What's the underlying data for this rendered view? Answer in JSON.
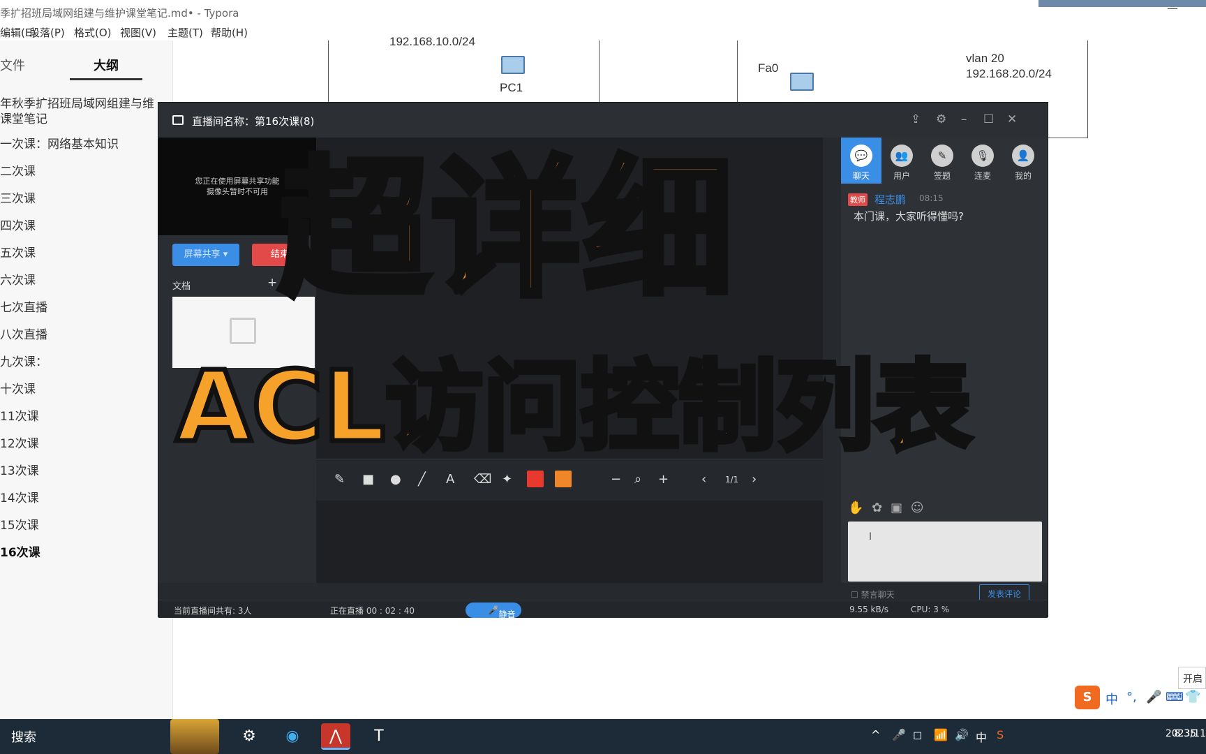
{
  "window": {
    "title": "季扩招班局域网组建与维护课堂笔记.md• - Typora"
  },
  "menu": [
    "编辑(E)",
    "段落(P)",
    "格式(O)",
    "视图(V)",
    "主题(T)",
    "帮助(H)"
  ],
  "sidebar": {
    "tabs": [
      "文件",
      "大纲"
    ],
    "active_tab": "大纲",
    "outline": [
      "年秋季扩招班局域网组建与维",
      "课堂笔记",
      "一次课：网络基本知识",
      "二次课",
      "三次课",
      "四次课",
      "五次课",
      "六次课",
      "七次直播",
      "八次直播",
      "九次课：",
      "十次课",
      "11次课",
      "12次课",
      "13次课",
      "14次课",
      "15次课",
      "16次课"
    ],
    "active_item": "16次课",
    "bottom_controls": [
      "<",
      "</>"
    ]
  },
  "diagram": {
    "subnet1": "192.168.10.0/24",
    "pc1": "PC1",
    "port": "Fa0",
    "vlan": "vlan 20",
    "subnet2": "192.168.20.0/24"
  },
  "live": {
    "title": "直播间名称：第16次课(8)",
    "camera_notice": "您正在使用屏幕共享功能\n摄像头暂时不可用",
    "share_button": "屏幕共享 ▾",
    "red_button": "结束",
    "doc_label": "文档",
    "doc_add": "+",
    "right_tabs": [
      {
        "label": "聊天",
        "icon": "chat-icon"
      },
      {
        "label": "用户",
        "icon": "users-icon"
      },
      {
        "label": "签题",
        "icon": "pen-icon"
      },
      {
        "label": "连麦",
        "icon": "mic-icon"
      },
      {
        "label": "我的",
        "icon": "profile-icon"
      }
    ],
    "active_right_tab": "聊天",
    "chat": {
      "badge": "教师",
      "name": "程志鹏",
      "time": "08:15",
      "message": "本门课，大家听得懂吗?"
    },
    "input_cursor": "I",
    "private_chat": "禁言聊天",
    "send_button": "发表评论",
    "page_indicator": "1/1",
    "colors": {
      "red_swatch": "#e8392f",
      "orange_swatch": "#f0862a",
      "accent": "#3a8ee6"
    },
    "status": {
      "viewers": "当前直播间共有: 3人",
      "live_time": "正在直播 00 : 02 : 40",
      "mute_button": "静音",
      "speed": "9.55 kB/s",
      "cpu": "CPU: 3 %"
    }
  },
  "overlay": {
    "title": "超详细",
    "subtitle": "ACL访问控制列表"
  },
  "ime": {
    "logo": "S",
    "items": [
      "中",
      "°,",
      "🎤",
      "⌨",
      "👕"
    ],
    "popup": "开启"
  },
  "taskbar": {
    "search": "搜索",
    "tray_items": [
      "^",
      "🎤",
      "◻",
      "📶",
      "🔊",
      "中",
      "S"
    ],
    "time": "8:35",
    "date": "2023/11"
  }
}
